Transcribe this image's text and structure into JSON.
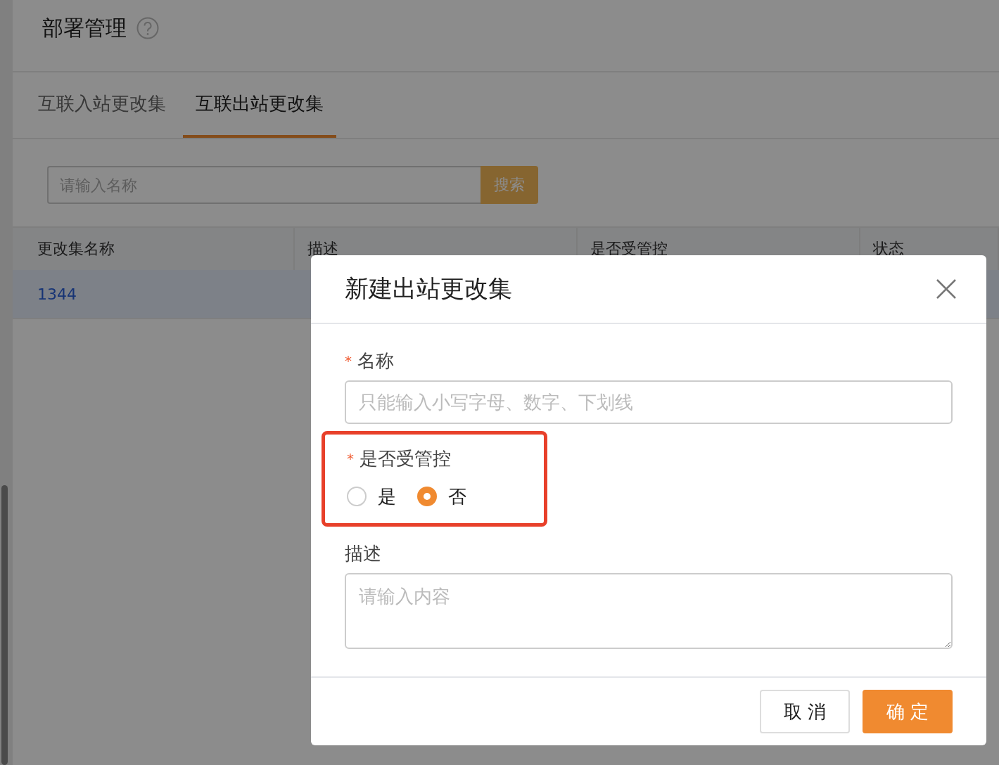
{
  "page": {
    "title": "部署管理"
  },
  "tabs": [
    {
      "label": "互联入站更改集",
      "selected": false
    },
    {
      "label": "互联出站更改集",
      "selected": true
    }
  ],
  "search": {
    "placeholder": "请输入名称",
    "button": "搜索"
  },
  "table": {
    "columns": [
      "更改集名称",
      "描述",
      "是否受管控",
      "状态"
    ],
    "rows": [
      {
        "cells": [
          "1344"
        ],
        "selected": true
      }
    ]
  },
  "dialog": {
    "title": "新建出站更改集",
    "fields": [
      {
        "kind": "text",
        "label": "名称",
        "required_mark": "*",
        "placeholder": "只能输入小写字母、数字、下划线"
      },
      {
        "kind": "radio",
        "label": "是否受管控",
        "required_mark": "*",
        "highlighted": true,
        "options": [
          {
            "label": "是",
            "selected": false
          },
          {
            "label": "否",
            "selected": true
          }
        ]
      },
      {
        "kind": "textarea",
        "label": "描述",
        "placeholder": "请输入内容"
      }
    ],
    "buttons": [
      {
        "label": "取 消",
        "kind": "secondary"
      },
      {
        "label": "确 定",
        "kind": "primary"
      }
    ]
  }
}
